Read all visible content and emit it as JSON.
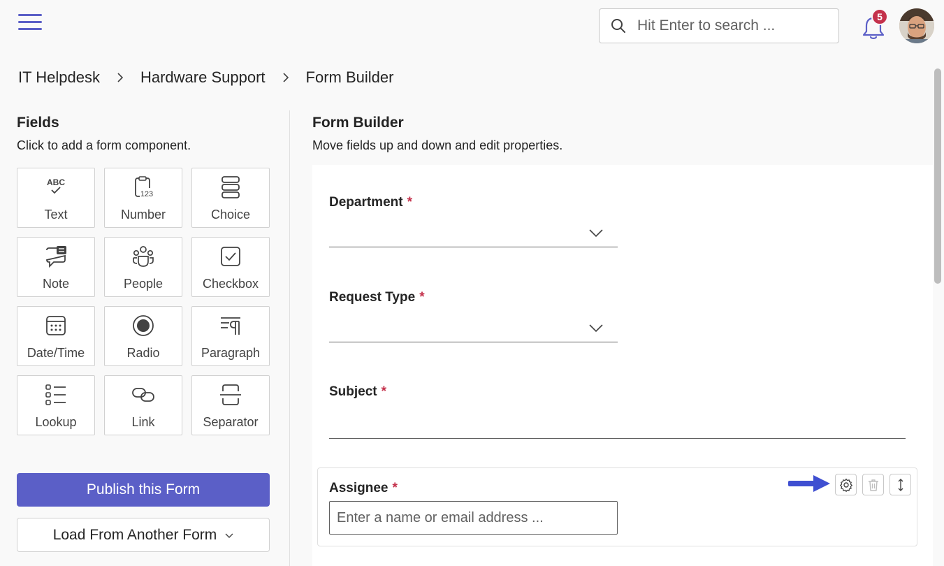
{
  "header": {
    "menu_icon": "hamburger-menu-icon",
    "search": {
      "placeholder": "Hit Enter to search ...",
      "icon": "search-icon"
    },
    "notifications": {
      "icon": "bell-icon",
      "count": "5"
    },
    "avatar": "user-avatar"
  },
  "breadcrumb": [
    "IT Helpdesk",
    "Hardware Support",
    "Form Builder"
  ],
  "fields_panel": {
    "title": "Fields",
    "subtitle": "Click to add a form component.",
    "items": [
      {
        "label": "Text",
        "icon": "text-abc-icon"
      },
      {
        "label": "Number",
        "icon": "number-123-icon"
      },
      {
        "label": "Choice",
        "icon": "choice-list-icon"
      },
      {
        "label": "Note",
        "icon": "note-icon"
      },
      {
        "label": "People",
        "icon": "people-icon"
      },
      {
        "label": "Checkbox",
        "icon": "checkbox-icon"
      },
      {
        "label": "Date/Time",
        "icon": "calendar-icon"
      },
      {
        "label": "Radio",
        "icon": "radio-icon"
      },
      {
        "label": "Paragraph",
        "icon": "paragraph-icon"
      },
      {
        "label": "Lookup",
        "icon": "lookup-list-icon"
      },
      {
        "label": "Link",
        "icon": "link-icon"
      },
      {
        "label": "Separator",
        "icon": "separator-icon"
      }
    ],
    "publish_label": "Publish this Form",
    "load_label": "Load From Another Form"
  },
  "builder": {
    "title": "Form Builder",
    "subtitle": "Move fields up and down and edit properties.",
    "fields": [
      {
        "label": "Department",
        "required": "*",
        "type": "dropdown"
      },
      {
        "label": "Request Type",
        "required": "*",
        "type": "dropdown"
      },
      {
        "label": "Subject",
        "required": "*",
        "type": "text"
      },
      {
        "label": "Assignee",
        "required": "*",
        "type": "people",
        "placeholder": "Enter a name or email address ..."
      }
    ],
    "tools": [
      "settings-gear-icon",
      "delete-trash-icon",
      "move-arrows-icon"
    ]
  },
  "colors": {
    "accent": "#5b5fc7",
    "required": "#c4314b",
    "arrow": "#3f4fd1",
    "badge": "#c4314b"
  }
}
